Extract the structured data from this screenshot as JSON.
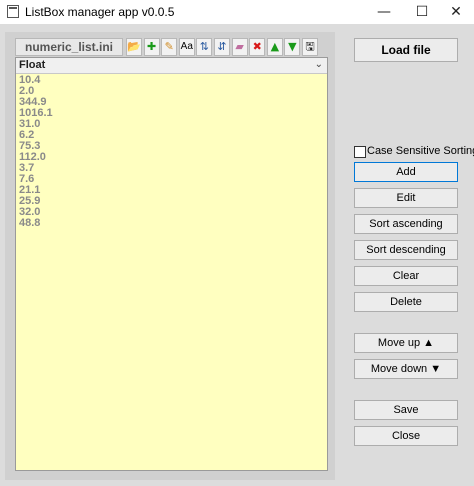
{
  "window": {
    "title": "ListBox manager app v0.0.5",
    "minimize": "—",
    "maximize": "☐",
    "close": "✕"
  },
  "toolbar": {
    "file_name": "numeric_list.ini",
    "tools": [
      {
        "icon": "folder-open-icon",
        "glyph": "📂",
        "color": "#2a7fd4"
      },
      {
        "icon": "add-icon",
        "glyph": "✚",
        "color": "#1a9a1a"
      },
      {
        "icon": "edit-pencil-icon",
        "glyph": "✎",
        "color": "#d08a20"
      },
      {
        "icon": "case-toggle-icon",
        "glyph": "Aa",
        "color": "#000000"
      },
      {
        "icon": "sort-ascending-icon",
        "glyph": "⇅",
        "color": "#2a5aa0"
      },
      {
        "icon": "sort-descending-icon",
        "glyph": "⇵",
        "color": "#2a5aa0"
      },
      {
        "icon": "clear-eraser-icon",
        "glyph": "▰",
        "color": "#c06fa0"
      },
      {
        "icon": "delete-icon",
        "glyph": "✖",
        "color": "#d81818"
      },
      {
        "icon": "move-up-icon",
        "glyph": "▲",
        "color": "#1a9a1a"
      },
      {
        "icon": "move-down-icon",
        "glyph": "▼",
        "color": "#1a9a1a"
      },
      {
        "icon": "save-icon",
        "glyph": "🖫",
        "color": "#222222"
      }
    ]
  },
  "list": {
    "header": "Float",
    "items": [
      "10.4",
      "2.0",
      "344.9",
      "1016.1",
      "31.0",
      "6.2",
      "75.3",
      "112.0",
      "3.7",
      "7.6",
      "21.1",
      "25.9",
      "32.0",
      "48.8"
    ]
  },
  "controls": {
    "load_file": "Load file",
    "case_sensitive": "Case Sensitive Sorting",
    "add": "Add",
    "edit": "Edit",
    "sort_ascending": "Sort ascending",
    "sort_descending": "Sort descending",
    "clear": "Clear",
    "delete": "Delete",
    "move_up": "Move up ▲",
    "move_down": "Move down ▼",
    "save": "Save",
    "close": "Close"
  },
  "colors": {
    "list_background": "#ffffc0",
    "list_text": "#8a8a8a",
    "focus_border": "#0078d7"
  }
}
